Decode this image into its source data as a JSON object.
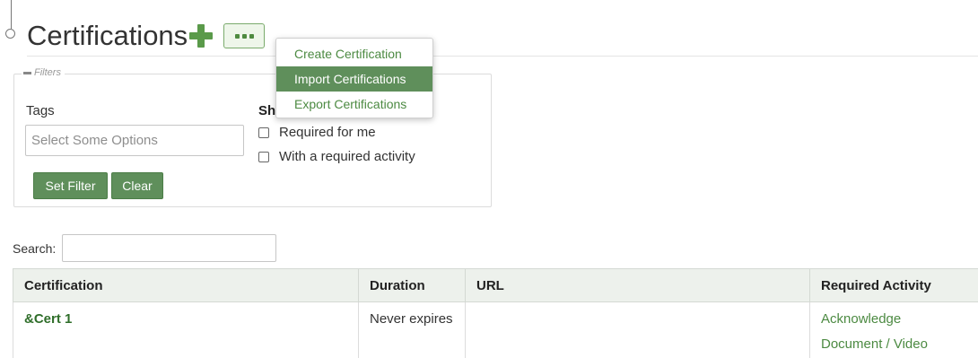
{
  "header": {
    "title": "Certifications"
  },
  "menu": {
    "items": [
      "Create Certification",
      "Import Certifications",
      "Export Certifications"
    ],
    "active_index": 1
  },
  "filters": {
    "legend": "Filters",
    "tags_label": "Tags",
    "tags_placeholder": "Select Some Options",
    "show_label": "Sh",
    "checkboxes": [
      {
        "label": "Required for me",
        "checked": false
      },
      {
        "label": "With a required activity",
        "checked": false
      }
    ],
    "set_filter_label": "Set Filter",
    "clear_label": "Clear"
  },
  "search": {
    "label": "Search:",
    "value": ""
  },
  "table": {
    "headers": [
      "Certification",
      "Duration",
      "URL",
      "Required Activity"
    ],
    "rows": [
      {
        "certification": "&Cert 1",
        "duration": "Never expires",
        "url": "",
        "required_activity": [
          "Acknowledge",
          "Document / Video"
        ]
      }
    ]
  },
  "colors": {
    "accent": "#5f8f5b",
    "link": "#4c8a42",
    "plus_icon": "#5a9a4a",
    "header_bg": "#edf1ec"
  },
  "icons": [
    "timeline-node-icon",
    "plus-icon",
    "more-icon",
    "minus-icon",
    "checkbox-icon"
  ]
}
